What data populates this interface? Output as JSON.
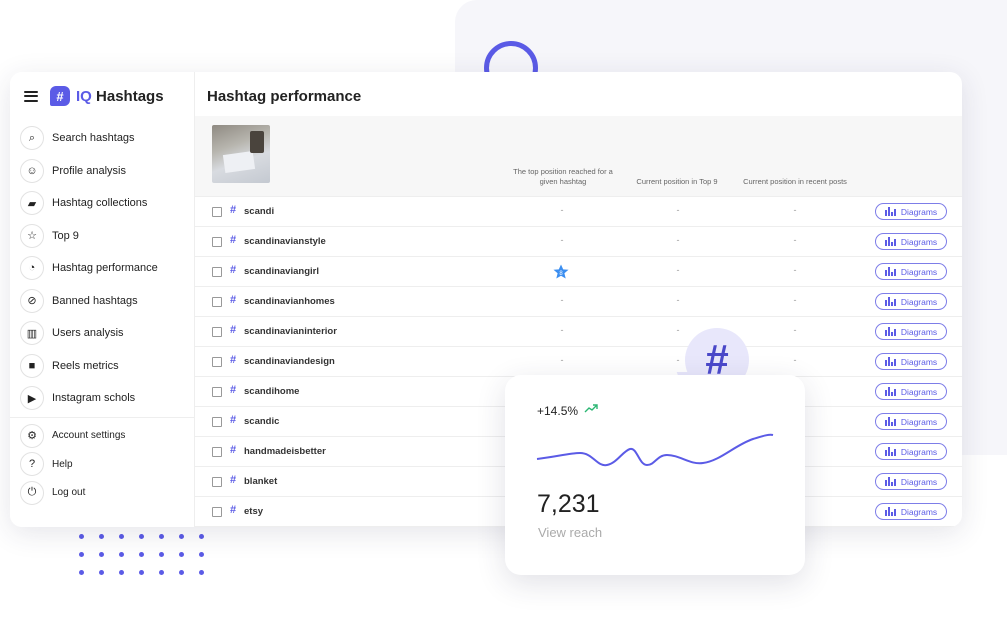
{
  "brand": {
    "prefix": "IQ",
    "name": "Hashtags",
    "accent": "#5b5be6"
  },
  "sidebar": {
    "items": [
      {
        "label": "Search hashtags",
        "icon": "search-icon"
      },
      {
        "label": "Profile analysis",
        "icon": "face-icon"
      },
      {
        "label": "Hashtag collections",
        "icon": "folder-icon"
      },
      {
        "label": "Top 9",
        "icon": "star-icon"
      },
      {
        "label": "Hashtag performance",
        "icon": "gauge-icon"
      },
      {
        "label": "Banned hashtags",
        "icon": "ban-icon"
      },
      {
        "label": "Users analysis",
        "icon": "chart-icon"
      },
      {
        "label": "Reels metrics",
        "icon": "video-icon"
      },
      {
        "label": "Instagram schols",
        "icon": "play-icon"
      }
    ],
    "bottom": [
      {
        "label": "Account settings",
        "icon": "gear-icon"
      },
      {
        "label": "Help",
        "icon": "help-icon"
      },
      {
        "label": "Log out",
        "icon": "power-icon"
      }
    ]
  },
  "main": {
    "title": "Hashtag performance",
    "columns": [
      "The top position reached for a given hashtag",
      "Current position in Top 9",
      "Current position in recent posts"
    ],
    "button_label": "Diagrams",
    "rows": [
      {
        "tag": "scandi",
        "top": "-",
        "top9": "-",
        "recent": "-"
      },
      {
        "tag": "scandinavianstyle",
        "top": "-",
        "top9": "-",
        "recent": "-"
      },
      {
        "tag": "scandinaviangirl",
        "top": "8",
        "top9": "-",
        "recent": "-"
      },
      {
        "tag": "scandinavianhomes",
        "top": "-",
        "top9": "-",
        "recent": "-"
      },
      {
        "tag": "scandinavianinterior",
        "top": "-",
        "top9": "-",
        "recent": "-"
      },
      {
        "tag": "scandinaviandesign",
        "top": "-",
        "top9": "-",
        "recent": "-"
      },
      {
        "tag": "scandihome",
        "top": "",
        "top9": "",
        "recent": ""
      },
      {
        "tag": "scandic",
        "top": "",
        "top9": "",
        "recent": ""
      },
      {
        "tag": "handmadeisbetter",
        "top": "",
        "top9": "",
        "recent": ""
      },
      {
        "tag": "blanket",
        "top": "",
        "top9": "",
        "recent": ""
      },
      {
        "tag": "etsy",
        "top": "",
        "top9": "",
        "recent": ""
      }
    ]
  },
  "card": {
    "change": "+14.5%",
    "value": "7,231",
    "label": "View reach"
  },
  "bubble": {
    "symbol": "#"
  }
}
